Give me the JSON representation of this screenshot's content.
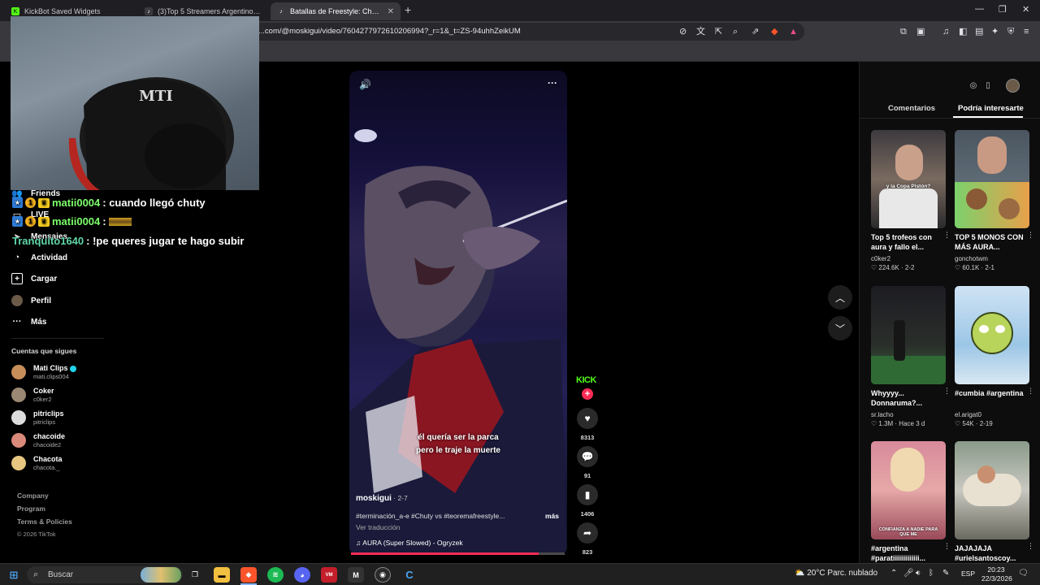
{
  "browser": {
    "tabs": [
      {
        "title": "KickBot Saved Widgets",
        "active": false
      },
      {
        "title": "(3)Top 5 Streamers Argentinos con M",
        "active": false
      },
      {
        "title": "Batallas de Freestyle: Chuty vs Te",
        "active": true
      }
    ],
    "url": "...com/@moskigui/video/7604277972610206994?_r=1&_t=ZS-94uhhZeikUM"
  },
  "overlay": {
    "webcam_chair_text": "MTI",
    "chat": [
      {
        "user": "matii0004",
        "message": ": cuando llegó chuty"
      },
      {
        "user": "matii0004",
        "message": ":"
      },
      {
        "user": "Tranquito1640",
        "message": ": !pe queres jugar  te hago subir"
      }
    ]
  },
  "sidebar": {
    "items": [
      {
        "label": "Friends",
        "icon": "users-icon"
      },
      {
        "label": "LIVE",
        "icon": "live-icon"
      },
      {
        "label": "Mensajes",
        "icon": "send-icon"
      },
      {
        "label": "Actividad",
        "icon": "bell-icon"
      },
      {
        "label": "Cargar",
        "icon": "upload-icon"
      },
      {
        "label": "Perfil",
        "icon": "profile-icon"
      },
      {
        "label": "Más",
        "icon": "more-icon"
      }
    ],
    "following_heading": "Cuentas que sigues",
    "following": [
      {
        "name": "Mati Clips",
        "handle": "mati.clips004",
        "verified": true,
        "color": "#c88e5a"
      },
      {
        "name": "Coker",
        "handle": "c0ker2",
        "verified": false,
        "color": "#9a8874"
      },
      {
        "name": "pitriclips",
        "handle": "pitriclips",
        "verified": false,
        "color": "#dddddd"
      },
      {
        "name": "chacoide",
        "handle": "chacoide2",
        "verified": false,
        "color": "#d98a7a"
      },
      {
        "name": "Chacota",
        "handle": "chacota._",
        "verified": false,
        "color": "#e6c680"
      }
    ],
    "footer": [
      "Company",
      "Program",
      "Terms & Policies",
      "© 2026 TikTok"
    ]
  },
  "video": {
    "subtitle_line1": "él quería ser la parca",
    "subtitle_line2": "pero le traje la muerte",
    "author": "moskigui",
    "date": " · 2-7",
    "caption": "#terminación_a-e #Chuty vs #teoremafreestyle...",
    "more": "más",
    "translate": "Ver traducción",
    "music": "AURA (Super Slowed) - Ogryzek",
    "progress": 0.88,
    "actions": {
      "kick": "KICK",
      "likes": "8313",
      "comments": "91",
      "saves": "1406",
      "shares": "823"
    }
  },
  "right_panel": {
    "tabs": [
      "Comentarios",
      "Podría interesarte"
    ],
    "cards": [
      {
        "title": "Top 5 trofeos con aura y fallo el...",
        "author": "c0ker2",
        "meta": "♡ 224.6K · 2-2",
        "overlay": "y la Copa Pistón?"
      },
      {
        "title": "TOP 5 MONOS CON MÁS AURA...",
        "author": "gonchotwm",
        "meta": "♡ 60.1K · 2-1",
        "overlay": ""
      },
      {
        "title": "Whyyyy... Donnaruma?...",
        "author": "sr.lacho",
        "meta": "♡ 1.3M · Hace 3 d",
        "overlay": ""
      },
      {
        "title": "#cumbia #argentina",
        "author": "el.arigat0",
        "meta": "♡ 54K · 2-19",
        "overlay": ""
      },
      {
        "title": "#argentina #paratiiiiiiiiiiiii...",
        "author": "",
        "meta": "",
        "overlay": "CONFIANZA A NADIE PARA QUE ME"
      },
      {
        "title": "JAJAJAJA #urielsantoscoy...",
        "author": "",
        "meta": "",
        "overlay": ""
      }
    ]
  },
  "taskbar": {
    "search_placeholder": "Buscar",
    "weather": "20°C  Parc. nublado",
    "lang": "ESP",
    "time": "20:23",
    "date": "22/3/2026"
  }
}
